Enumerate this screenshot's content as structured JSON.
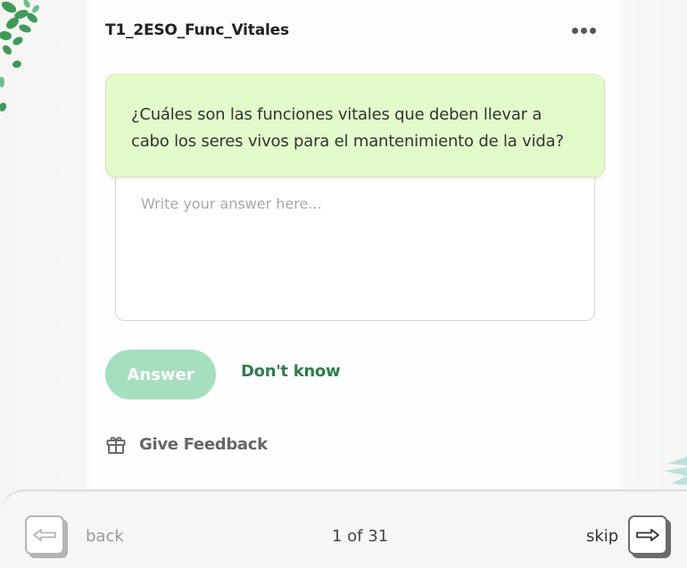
{
  "deck": {
    "title": "T1_2ESO_Func_Vitales"
  },
  "menu": {
    "icon": "more-horizontal-icon"
  },
  "question": {
    "text": "¿Cuáles son las funciones vitales que deben llevar a cabo los seres vivos para el mantenimiento de la vida?"
  },
  "answer": {
    "value": "",
    "placeholder": "Write your answer here..."
  },
  "actions": {
    "answer_label": "Answer",
    "dont_know_label": "Don't know"
  },
  "feedback": {
    "icon": "gift-icon",
    "label": "Give Feedback"
  },
  "navigation": {
    "back_label": "back",
    "back_icon": "arrow-left-icon",
    "progress": "1 of 31",
    "skip_label": "skip",
    "skip_icon": "arrow-right-icon"
  },
  "colors": {
    "question_bg": "#e3fbcb",
    "answer_button_bg": "#a6dfc0",
    "dont_know_color": "#2e7d4e",
    "leaf_green": "#3f9a5a",
    "leaf_teal": "#bfe0dc"
  }
}
